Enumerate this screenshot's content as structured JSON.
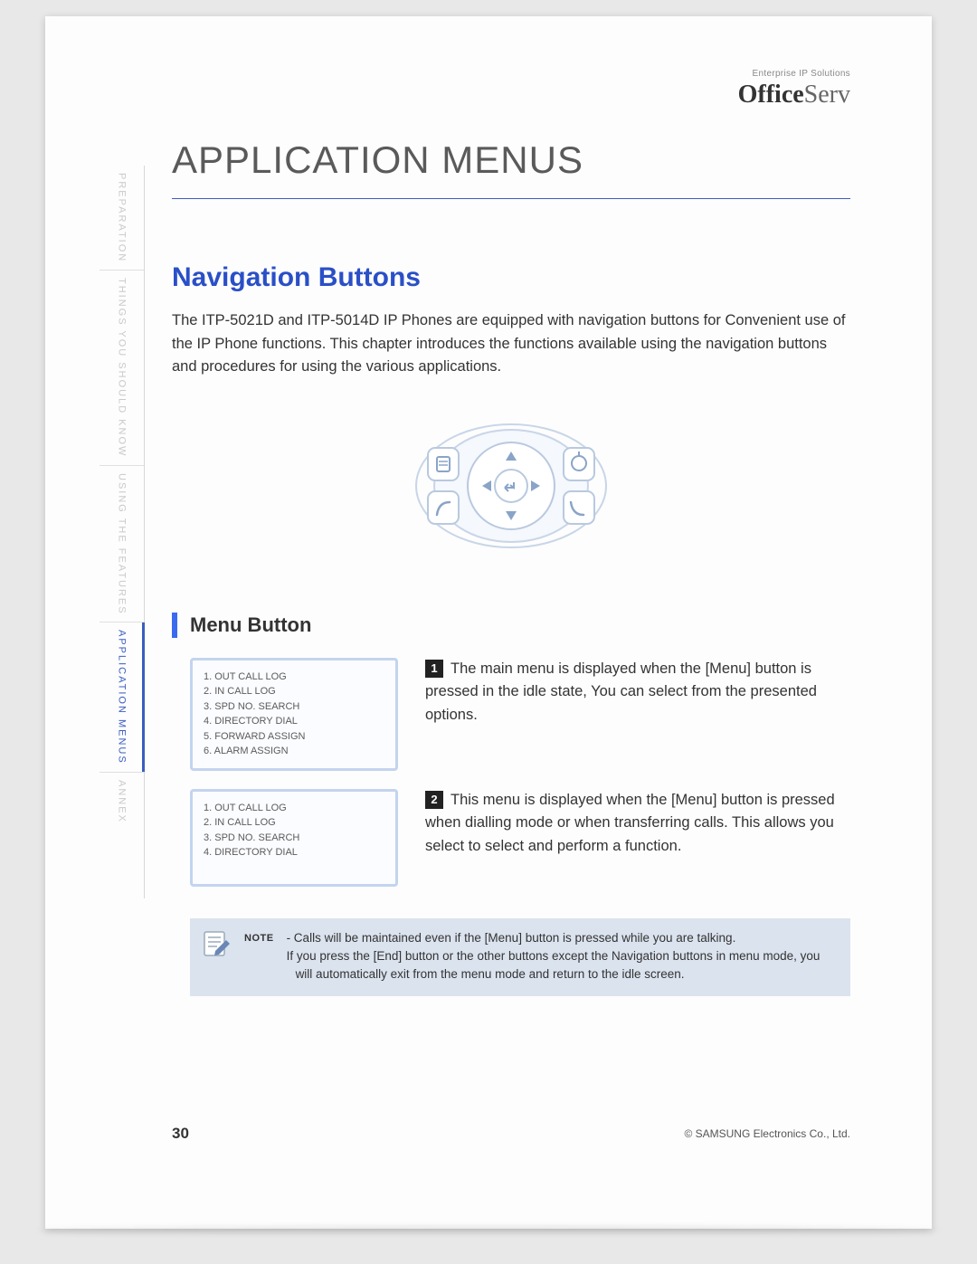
{
  "brand": {
    "tagline": "Enterprise IP Solutions",
    "name_bold": "Office",
    "name_light": "Serv"
  },
  "sidebar": {
    "items": [
      "PREPARATION",
      "THINGS YOU SHOULD KNOW",
      "USING THE FEATURES",
      "APPLICATION MENUS",
      "ANNEX"
    ],
    "active_index": 3
  },
  "chapter_title": "APPLICATION MENUS",
  "section": {
    "title": "Navigation Buttons",
    "body": "The ITP-5021D and ITP-5014D IP Phones are equipped with navigation buttons for Convenient use of the IP Phone functions. This chapter introduces the functions available using the navigation buttons and procedures for using the various applications."
  },
  "sub_heading": "Menu Button",
  "menu_steps": [
    {
      "num": "1",
      "lcd_lines": [
        "1. OUT CALL LOG",
        "2. IN CALL LOG",
        "3. SPD NO. SEARCH",
        "4. DIRECTORY DIAL",
        "5. FORWARD ASSIGN",
        "6. ALARM ASSIGN"
      ],
      "text": "The main menu is displayed when the [Menu] button is pressed in the idle state, You can select from the presented options."
    },
    {
      "num": "2",
      "lcd_lines": [
        "1. OUT CALL LOG",
        "2. IN CALL LOG",
        "3. SPD NO. SEARCH",
        "4. DIRECTORY DIAL"
      ],
      "text": "This menu is displayed when the [Menu] button is pressed when dialling mode or when transferring calls. This allows you select to select and perform a function."
    }
  ],
  "note": {
    "label": "NOTE",
    "lines": [
      "- Calls will be maintained even if the [Menu] button is pressed while you are talking.",
      "If you press the [End] button or the other buttons except the Navigation buttons in menu mode, you will automatically exit from the menu mode and return to the idle screen."
    ]
  },
  "footer": {
    "page": "30",
    "copyright": "© SAMSUNG Electronics Co., Ltd."
  }
}
